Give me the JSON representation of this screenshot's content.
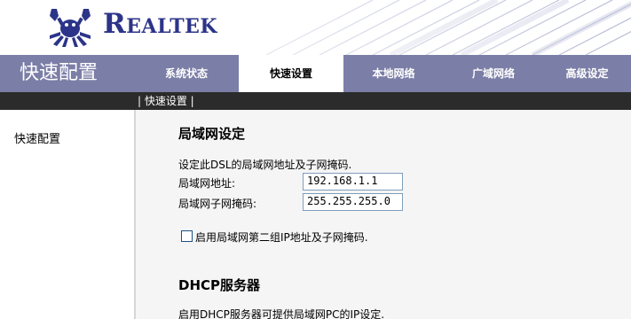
{
  "header": {
    "brand": "Realtek"
  },
  "nav": {
    "title": "快速配置",
    "tabs": [
      {
        "label": "系统状态",
        "active": false
      },
      {
        "label": "快速设置",
        "active": true
      },
      {
        "label": "本地网络",
        "active": false
      },
      {
        "label": "广域网络",
        "active": false
      },
      {
        "label": "高级设定",
        "active": false
      }
    ]
  },
  "subnav": {
    "item": "| 快速设置 |"
  },
  "sidebar": {
    "items": [
      {
        "label": "快速配置"
      }
    ]
  },
  "lan": {
    "title": "局域网设定",
    "description": "设定此DSL的局域网地址及子网掩码.",
    "ip_label": "局域网地址:",
    "ip_value": "192.168.1.1",
    "mask_label": "局域网子网掩码:",
    "mask_value": "255.255.255.0",
    "secondary_label": "启用局域网第二组IP地址及子网掩码.",
    "secondary_checked": false
  },
  "dhcp": {
    "title": "DHCP服务器",
    "description": "启用DHCP服务器可提供局域网PC的IP设定."
  },
  "colors": {
    "brand": "#2c3489",
    "navbar": "#7b7ea6",
    "subnav": "#2b2b2b",
    "content_bg": "#f5f5f5"
  }
}
